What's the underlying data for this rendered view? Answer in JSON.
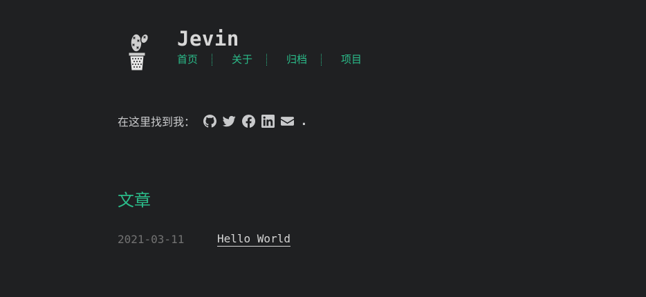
{
  "site": {
    "title": "Jevin"
  },
  "nav": {
    "items": [
      {
        "label": "首页"
      },
      {
        "label": "关于"
      },
      {
        "label": "归档"
      },
      {
        "label": "项目"
      }
    ]
  },
  "social": {
    "label": "在这里找到我：",
    "icons": [
      "github-icon",
      "twitter-icon",
      "facebook-icon",
      "linkedin-icon",
      "envelope-icon"
    ],
    "period": "."
  },
  "posts": {
    "section_title": "文章",
    "items": [
      {
        "date": "2021-03-11",
        "title": "Hello World"
      }
    ]
  },
  "colors": {
    "background": "#1f2022",
    "accent": "#2bbc8a",
    "text": "#c9cacc",
    "muted": "#737373"
  }
}
